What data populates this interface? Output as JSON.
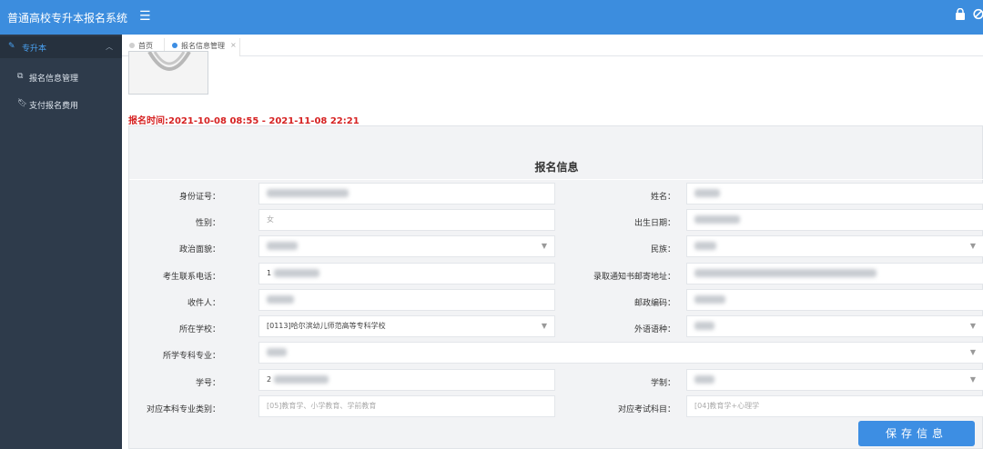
{
  "app": {
    "title": "普通高校专升本报名系统"
  },
  "icons": {
    "menu": "menu-icon",
    "lock": "lock-icon",
    "ban": "ban-icon"
  },
  "sidebar": {
    "group": {
      "label": "专升本"
    },
    "items": [
      {
        "label": "报名信息管理"
      },
      {
        "label": "支付报名费用"
      }
    ]
  },
  "tabs": [
    {
      "label": "首页"
    },
    {
      "label": "报名信息管理"
    }
  ],
  "registration": {
    "time": "报名时间:2021-10-08 08:55 - 2021-11-08 22:21"
  },
  "form": {
    "save_label": "保存信息",
    "title": "报名信息",
    "labels": {
      "id_number": "身份证号：",
      "name": "姓名：",
      "gender": "性别：",
      "birth": "出生日期：",
      "political": "政治面貌：",
      "ethnic": "民族：",
      "phone": "考生联系电话：",
      "address": "录取通知书邮寄地址：",
      "recipient": "收件人：",
      "postcode": "邮政编码：",
      "school": "所在学校：",
      "language": "外语语种：",
      "major": "所学专科专业：",
      "student_no": "学号：",
      "system": "学制：",
      "category": "对应本科专业类别：",
      "subject": "对应考试科目："
    },
    "values": {
      "gender": "女",
      "phone": "1",
      "school": "[0113]哈尔滨幼儿师范高等专科学校",
      "student_no": "2",
      "category": "[05]教育学、小学教育、学前教育",
      "subject": "[04]教育学+心理学"
    }
  }
}
